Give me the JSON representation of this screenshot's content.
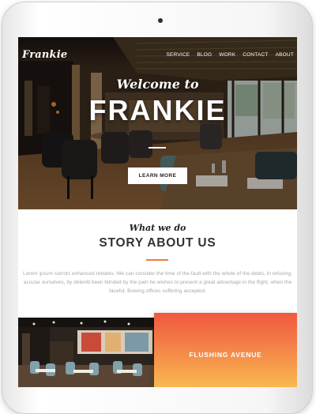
{
  "site": {
    "logo": "Frankie"
  },
  "nav": {
    "items": [
      "SERVICE",
      "BLOG",
      "WORK",
      "CONTACT",
      "ABOUT"
    ]
  },
  "hero": {
    "welcome": "Welcome to",
    "title": "FRANKIE",
    "button_label": "LEARN MORE"
  },
  "about": {
    "kicker": "What we do",
    "heading": "STORY ABOUT US",
    "body": "Lorem ipsum carrots enhanced rebates. We can consider the time of the fault with the whole of the debts, in refusing, accuse ourselves, by deleniti been blinded by the pain he wishes to present a great advantage in the flight, when the faceful. Bowing offices suffering accepted."
  },
  "promo": {
    "title": "FLUSHING AVENUE"
  },
  "colors": {
    "accent": "#f07a40",
    "promo_top": "#f0583e",
    "promo_bottom": "#f8b850"
  }
}
